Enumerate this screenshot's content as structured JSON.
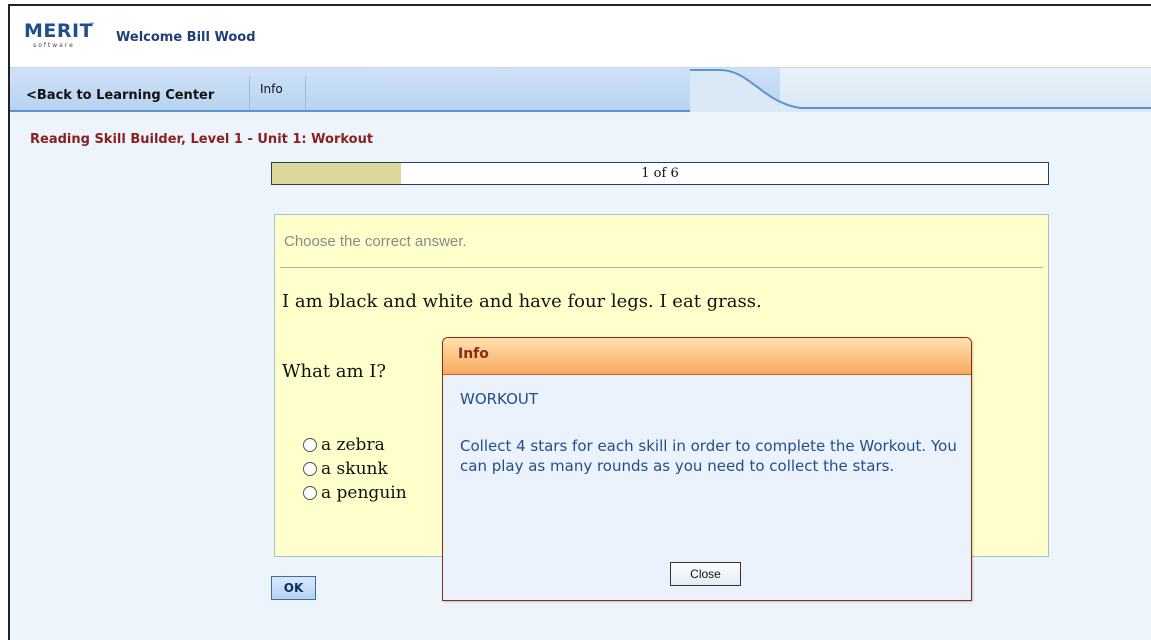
{
  "header": {
    "logo_text": "MERIT",
    "logo_sub": "software",
    "logo_tm": "™",
    "welcome": "Welcome Bill Wood"
  },
  "nav": {
    "back_label": "<Back to Learning Center",
    "info_label": "Info"
  },
  "breadcrumb": "Reading Skill Builder, Level 1 - Unit 1: Workout",
  "progress": {
    "text": "1 of 6",
    "current": 1,
    "total": 6
  },
  "question": {
    "instruction": "Choose the correct answer.",
    "text": "I am black and white and have four legs. I eat grass.",
    "ask": "What am I?",
    "options": [
      "a zebra",
      "a skunk",
      "a penguin"
    ]
  },
  "ok_label": "OK",
  "dialog": {
    "header": "Info",
    "title": "WORKOUT",
    "body": "Collect 4 stars for each skill in order to complete the Workout. You can play as many rounds as you need to collect the stars.",
    "close_label": "Close"
  },
  "colors": {
    "brand": "#1f4e8c",
    "breadcrumb": "#8b2020",
    "progress_fill": "#dcd79a",
    "question_bg": "#ffffcc",
    "dialog_header": "#f6a95d"
  }
}
